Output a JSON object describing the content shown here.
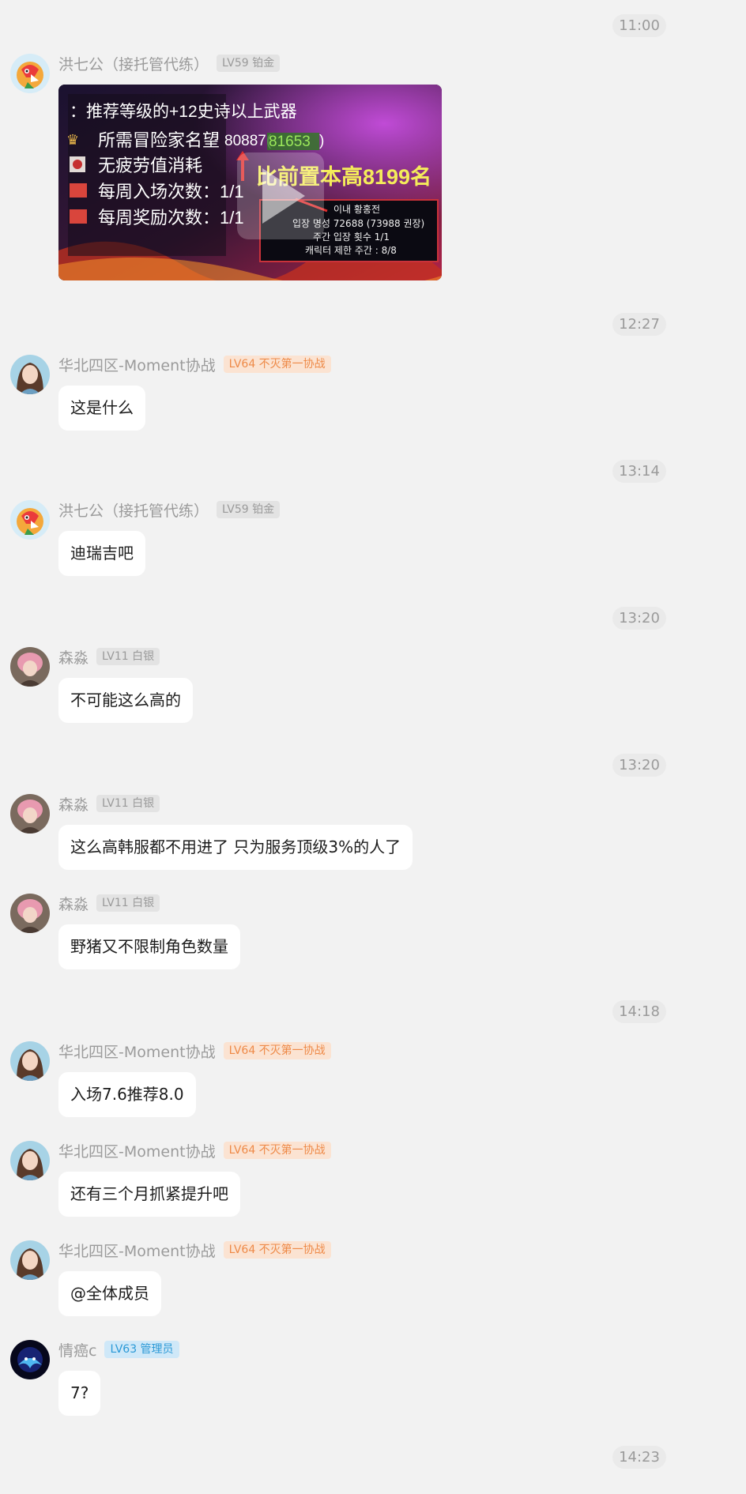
{
  "times": [
    "11:00",
    "12:27",
    "13:14",
    "13:20",
    "13:20",
    "14:18",
    "14:23"
  ],
  "messages": [
    {
      "sender": "洪七公（接托管代练）",
      "badge": "LV59 铂金",
      "video": {
        "lines": [
          "：推荐等级的+12史诗以上武器",
          "所需冒险家名望",
          "80887(",
          "81653",
          ")",
          "无疲劳值消耗",
          "每周入场次数：1/1",
          "每周奖励次数：1/1",
          "比前置本高8199名",
          "이내 황홍전",
          "입장 명성 72688 (73988 권장)",
          "주간 입장 횟수 1/1",
          "캐릭터 제한 주간 : 8/8"
        ]
      }
    },
    {
      "sender": "华北四区-Moment协战",
      "badge": "LV64 不灭第一协战",
      "text": "这是什么"
    },
    {
      "sender": "洪七公（接托管代练）",
      "badge": "LV59 铂金",
      "text": "迪瑞吉吧"
    },
    {
      "sender": "森淼",
      "badge": "LV11 白银",
      "text": "不可能这么高的"
    },
    {
      "sender": "森淼",
      "badge": "LV11 白银",
      "text": "这么高韩服都不用进了 只为服务顶级3%的人了"
    },
    {
      "sender": "森淼",
      "badge": "LV11 白银",
      "text": "野猪又不限制角色数量"
    },
    {
      "sender": "华北四区-Moment协战",
      "badge": "LV64 不灭第一协战",
      "text": "入场7.6推荐8.0"
    },
    {
      "sender": "华北四区-Moment协战",
      "badge": "LV64 不灭第一协战",
      "text": "还有三个月抓紧提升吧"
    },
    {
      "sender": "华北四区-Moment协战",
      "badge": "LV64 不灭第一协战",
      "text": "@全体成员"
    },
    {
      "sender": "情癌c",
      "badge": "LV63 管理员",
      "text": "7?"
    }
  ],
  "colors": {
    "background": "#f2f2f2",
    "bubble": "#ffffff",
    "badge_orange_text": "#ee8a48",
    "badge_blue_text": "#2b99d6"
  },
  "icons": {
    "play": "play-icon",
    "avatar_parrot": "parrot-avatar",
    "avatar_girl": "girl-avatar",
    "avatar_pink": "pink-hair-avatar",
    "avatar_dark": "dark-wolf-avatar"
  }
}
